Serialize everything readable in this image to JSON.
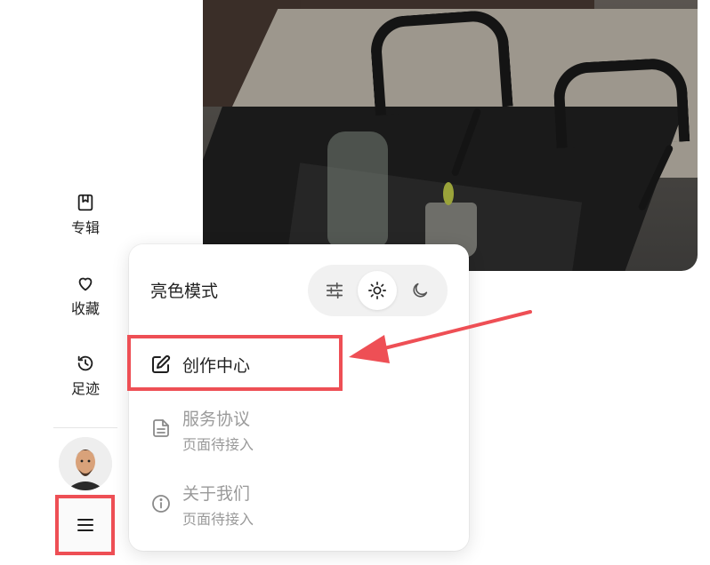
{
  "sidebar": {
    "items": [
      {
        "label": "专辑",
        "icon": "album-bookmark-icon"
      },
      {
        "label": "收藏",
        "icon": "heart-icon"
      },
      {
        "label": "足迹",
        "icon": "history-icon"
      }
    ],
    "avatar": {
      "icon": "user-avatar"
    },
    "menu_button": {
      "icon": "hamburger-menu-icon"
    }
  },
  "popup": {
    "theme": {
      "title": "亮色模式",
      "options": [
        {
          "icon": "sliders-icon"
        },
        {
          "icon": "sun-icon"
        },
        {
          "icon": "moon-icon"
        }
      ],
      "selected_index": 1
    },
    "items": [
      {
        "title": "创作中心",
        "icon": "edit-icon"
      },
      {
        "title": "服务协议",
        "subtitle": "页面待接入",
        "icon": "document-icon"
      },
      {
        "title": "关于我们",
        "subtitle": "页面待接入",
        "icon": "info-icon"
      }
    ]
  },
  "colors": {
    "highlight": "#ee4f55",
    "muted_text": "#9a9a9a"
  }
}
